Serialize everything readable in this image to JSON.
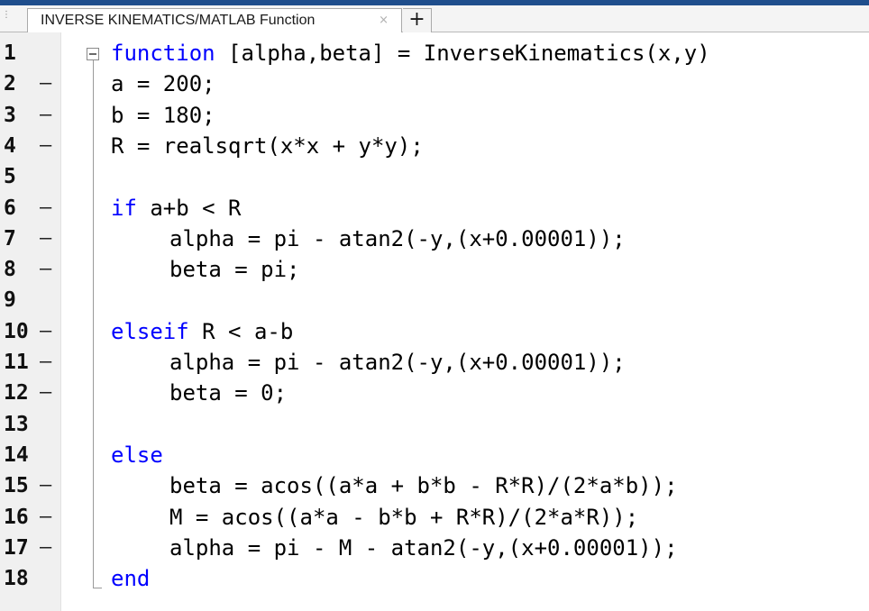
{
  "tab": {
    "title": "INVERSE KINEMATICS/MATLAB Function",
    "close_glyph": "×",
    "add_glyph": "+"
  },
  "editor": {
    "lines": [
      {
        "num": "1",
        "dash": "",
        "indent": 0,
        "kw": "function",
        "text": " [alpha,beta] = InverseKinematics(x,y)"
      },
      {
        "num": "2",
        "dash": "–",
        "indent": 0,
        "kw": "",
        "text": "a = 200;"
      },
      {
        "num": "3",
        "dash": "–",
        "indent": 0,
        "kw": "",
        "text": "b = 180;"
      },
      {
        "num": "4",
        "dash": "–",
        "indent": 0,
        "kw": "",
        "text": "R = realsqrt(x*x + y*y);"
      },
      {
        "num": "5",
        "dash": "",
        "indent": 0,
        "kw": "",
        "text": ""
      },
      {
        "num": "6",
        "dash": "–",
        "indent": 0,
        "kw": "if",
        "text": " a+b < R"
      },
      {
        "num": "7",
        "dash": "–",
        "indent": 1,
        "kw": "",
        "text": "alpha = pi - atan2(-y,(x+0.00001));"
      },
      {
        "num": "8",
        "dash": "–",
        "indent": 1,
        "kw": "",
        "text": "beta = pi;"
      },
      {
        "num": "9",
        "dash": "",
        "indent": 0,
        "kw": "",
        "text": ""
      },
      {
        "num": "10",
        "dash": "–",
        "indent": 0,
        "kw": "elseif",
        "text": " R < a-b"
      },
      {
        "num": "11",
        "dash": "–",
        "indent": 1,
        "kw": "",
        "text": "alpha = pi - atan2(-y,(x+0.00001));"
      },
      {
        "num": "12",
        "dash": "–",
        "indent": 1,
        "kw": "",
        "text": "beta = 0;"
      },
      {
        "num": "13",
        "dash": "",
        "indent": 0,
        "kw": "",
        "text": ""
      },
      {
        "num": "14",
        "dash": "",
        "indent": 0,
        "kw": "else",
        "text": ""
      },
      {
        "num": "15",
        "dash": "–",
        "indent": 1,
        "kw": "",
        "text": "beta = acos((a*a + b*b - R*R)/(2*a*b));"
      },
      {
        "num": "16",
        "dash": "–",
        "indent": 1,
        "kw": "",
        "text": "M = acos((a*a - b*b + R*R)/(2*a*R));"
      },
      {
        "num": "17",
        "dash": "–",
        "indent": 1,
        "kw": "",
        "text": "alpha = pi - M - atan2(-y,(x+0.00001));"
      },
      {
        "num": "18",
        "dash": "",
        "indent": 0,
        "kw": "end",
        "text": ""
      }
    ]
  },
  "colors": {
    "keyword": "#0000ff",
    "text": "#000000",
    "gutter": "#f0f0f0",
    "title_strip": "#1f4e8c"
  },
  "icons": {
    "grip": "grip-icon",
    "close": "close-icon",
    "add": "plus-icon",
    "fold": "fold-collapse-icon"
  }
}
